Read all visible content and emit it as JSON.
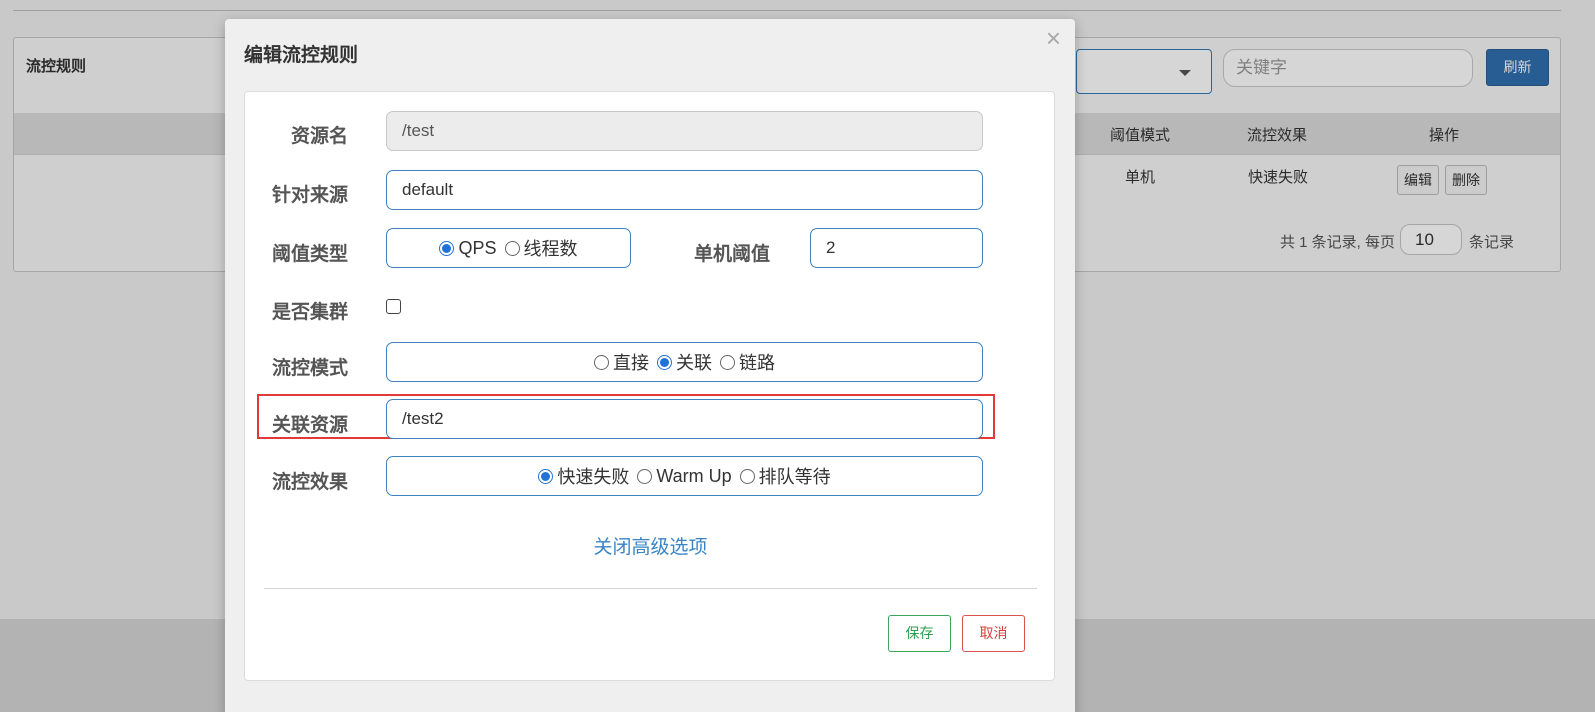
{
  "background": {
    "panel_title": "流控规则",
    "search": {
      "placeholder": "关键字"
    },
    "refresh_label": "刷新",
    "table": {
      "headers": [
        "阈值模式",
        "流控效果",
        "操作"
      ],
      "row": {
        "threshold_mode": "单机",
        "effect": "快速失败",
        "edit_label": "编辑",
        "delete_label": "删除"
      }
    },
    "pager": {
      "prefix": "共 1 条记录, 每页",
      "page_size": "10",
      "suffix": "条记录"
    }
  },
  "modal": {
    "title": "编辑流控规则",
    "close_glyph": "×",
    "form": {
      "resource": {
        "label": "资源名",
        "value": "/test"
      },
      "origin": {
        "label": "针对来源",
        "value": "default"
      },
      "threshold_type": {
        "label": "阈值类型",
        "options": [
          "QPS",
          "线程数"
        ],
        "selected": "QPS"
      },
      "single_threshold": {
        "label": "单机阈值",
        "value": "2"
      },
      "cluster": {
        "label": "是否集群",
        "checked": false
      },
      "flow_mode": {
        "label": "流控模式",
        "options": [
          "直接",
          "关联",
          "链路"
        ],
        "selected": "关联"
      },
      "related_resource": {
        "label": "关联资源",
        "value": "/test2"
      },
      "effect": {
        "label": "流控效果",
        "options": [
          "快速失败",
          "Warm Up",
          "排队等待"
        ],
        "selected": "快速失败"
      }
    },
    "advanced_link": "关闭高级选项",
    "save_label": "保存",
    "cancel_label": "取消"
  },
  "colors": {
    "accent": "#3f82bf",
    "highlight": "#e33939",
    "save": "#2e9e4f",
    "cancel": "#d43f3a"
  }
}
